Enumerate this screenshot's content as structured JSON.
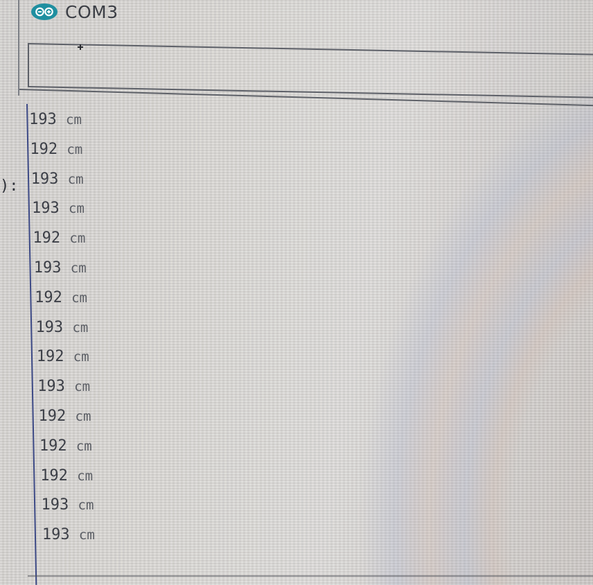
{
  "window": {
    "title": "COM3",
    "logo_icon": "arduino-infinity-icon",
    "accent": "#1f8fa0"
  },
  "send_input": {
    "value": ""
  },
  "left_fragment": "):",
  "serial_output": [
    {
      "value": "193",
      "unit": "cm"
    },
    {
      "value": "192",
      "unit": "cm"
    },
    {
      "value": "193",
      "unit": "cm"
    },
    {
      "value": "193",
      "unit": "cm"
    },
    {
      "value": "192",
      "unit": "cm"
    },
    {
      "value": "193",
      "unit": "cm"
    },
    {
      "value": "192",
      "unit": "cm"
    },
    {
      "value": "193",
      "unit": "cm"
    },
    {
      "value": "192",
      "unit": "cm"
    },
    {
      "value": "193",
      "unit": "cm"
    },
    {
      "value": "192",
      "unit": "cm"
    },
    {
      "value": "192",
      "unit": "cm"
    },
    {
      "value": "192",
      "unit": "cm"
    },
    {
      "value": "193",
      "unit": "cm"
    },
    {
      "value": "193",
      "unit": "cm"
    }
  ]
}
